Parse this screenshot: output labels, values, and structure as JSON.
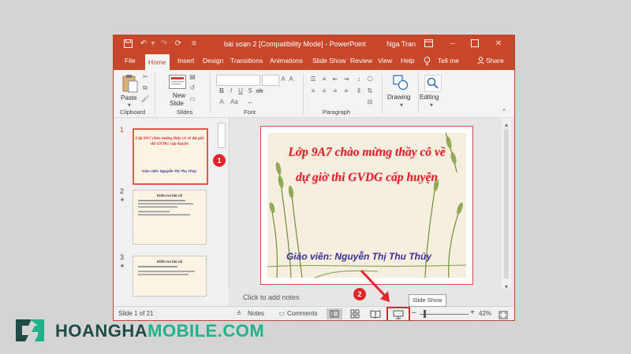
{
  "window": {
    "title": "bài soạn 2 [Compatibility Mode] - PowerPoint",
    "user": "Nga Tran"
  },
  "tabs": [
    {
      "label": "File"
    },
    {
      "label": "Home"
    },
    {
      "label": "Insert"
    },
    {
      "label": "Design"
    },
    {
      "label": "Transitions"
    },
    {
      "label": "Animations"
    },
    {
      "label": "Slide Show"
    },
    {
      "label": "Review"
    },
    {
      "label": "View"
    },
    {
      "label": "Help"
    },
    {
      "label": "Tell me"
    },
    {
      "label": "Share"
    }
  ],
  "ribbon": {
    "paste_label": "Paste",
    "new_slide_label1": "New",
    "new_slide_label2": "Slide",
    "drawing_label": "Drawing",
    "editing_label": "Editing",
    "groups": {
      "clipboard": "Clipboard",
      "slides": "Slides",
      "font": "Font",
      "paragraph": "Paragraph"
    }
  },
  "thumbnails": [
    {
      "number": "1",
      "title": "Lớp 9A7 chào mừng thầy cô về dự giờ thi GVDG cấp huyện",
      "subtitle": "Giáo viên: Nguyễn Thị Thu Thủy"
    },
    {
      "number": "2",
      "title": "Kiểm tra bài cũ"
    },
    {
      "number": "3",
      "title": "Kiểm tra bài cũ"
    }
  ],
  "slide": {
    "title_line1": "Lớp 9A7 chào mừng thầy cô về",
    "title_line2": "dự giờ thi GVDG cấp huyện",
    "teacher": "Giáo viên: Nguyễn Thị Thu Thủy"
  },
  "notes_placeholder": "Click to add notes",
  "statusbar": {
    "slide_count": "Slide 1 of 21",
    "notes": "Notes",
    "comments": "Comments",
    "zoom": "42%"
  },
  "tooltip": "Slide Show",
  "callouts": {
    "one": "1",
    "two": "2"
  },
  "branding": {
    "logo_text_part1": "HOANGHA",
    "logo_text_part2": "MOBILE.COM"
  },
  "colors": {
    "accent": "#c8472b",
    "callout": "#e0262d",
    "slide_title": "#e01d24",
    "slide_teacher": "#3a2d9a",
    "brand_dark": "#1f4a45",
    "brand_green": "#1fb38a"
  },
  "icons": {
    "save": "save-icon",
    "undo": "undo-icon",
    "redo": "redo-icon",
    "present": "present-icon",
    "customize": "customize-icon",
    "ribbon_display": "ribbon-display-icon",
    "minimize": "minimize-icon",
    "maximize": "maximize-icon",
    "close": "close-icon",
    "lightbulb": "lightbulb-icon",
    "share": "share-icon",
    "paste": "paste-icon",
    "new_slide": "new-slide-icon",
    "drawing": "drawing-icon",
    "editing": "editing-icon",
    "normal_view": "normal-view-icon",
    "sorter_view": "slide-sorter-icon",
    "reading_view": "reading-view-icon",
    "slideshow_view": "slideshow-view-icon"
  }
}
